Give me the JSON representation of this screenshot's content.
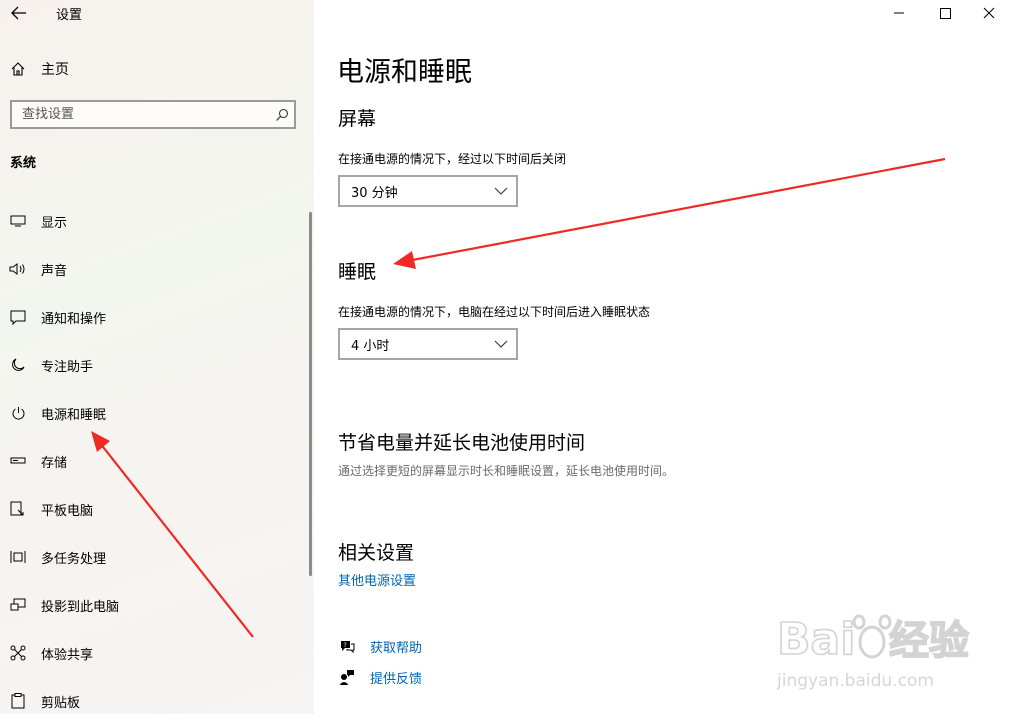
{
  "window": {
    "title": "设置",
    "controls": {
      "minimize_icon": "minimize-icon",
      "maximize_icon": "maximize-icon",
      "close_icon": "close-icon"
    }
  },
  "sidebar": {
    "home_label": "主页",
    "search_placeholder": "查找设置",
    "section_title": "系统",
    "items": [
      {
        "label": "显示",
        "icon": "display-icon"
      },
      {
        "label": "声音",
        "icon": "speaker-icon"
      },
      {
        "label": "通知和操作",
        "icon": "notification-icon"
      },
      {
        "label": "专注助手",
        "icon": "moon-icon"
      },
      {
        "label": "电源和睡眠",
        "icon": "power-icon"
      },
      {
        "label": "存储",
        "icon": "storage-icon"
      },
      {
        "label": "平板电脑",
        "icon": "tablet-icon"
      },
      {
        "label": "多任务处理",
        "icon": "multitask-icon"
      },
      {
        "label": "投影到此电脑",
        "icon": "project-icon"
      },
      {
        "label": "体验共享",
        "icon": "share-icon"
      },
      {
        "label": "剪贴板",
        "icon": "clipboard-icon"
      }
    ]
  },
  "main": {
    "title": "电源和睡眠",
    "screen": {
      "heading": "屏幕",
      "desc": "在接通电源的情况下，经过以下时间后关闭",
      "value": "30 分钟"
    },
    "sleep": {
      "heading": "睡眠",
      "desc": "在接通电源的情况下，电脑在经过以下时间后进入睡眠状态",
      "value": "4 小时"
    },
    "save": {
      "heading": "节省电量并延长电池使用时间",
      "desc": "通过选择更短的屏幕显示时长和睡眠设置，延长电池使用时间。"
    },
    "related": {
      "heading": "相关设置",
      "link": "其他电源设置"
    },
    "help": [
      {
        "label": "获取帮助",
        "icon": "help-chat-icon"
      },
      {
        "label": "提供反馈",
        "icon": "feedback-icon"
      }
    ]
  },
  "watermark": {
    "brand": "Baidu 经验",
    "url": "jingyan.baidu.com"
  },
  "colors": {
    "link": "#0064b4",
    "arrow": "#ee2a24"
  }
}
